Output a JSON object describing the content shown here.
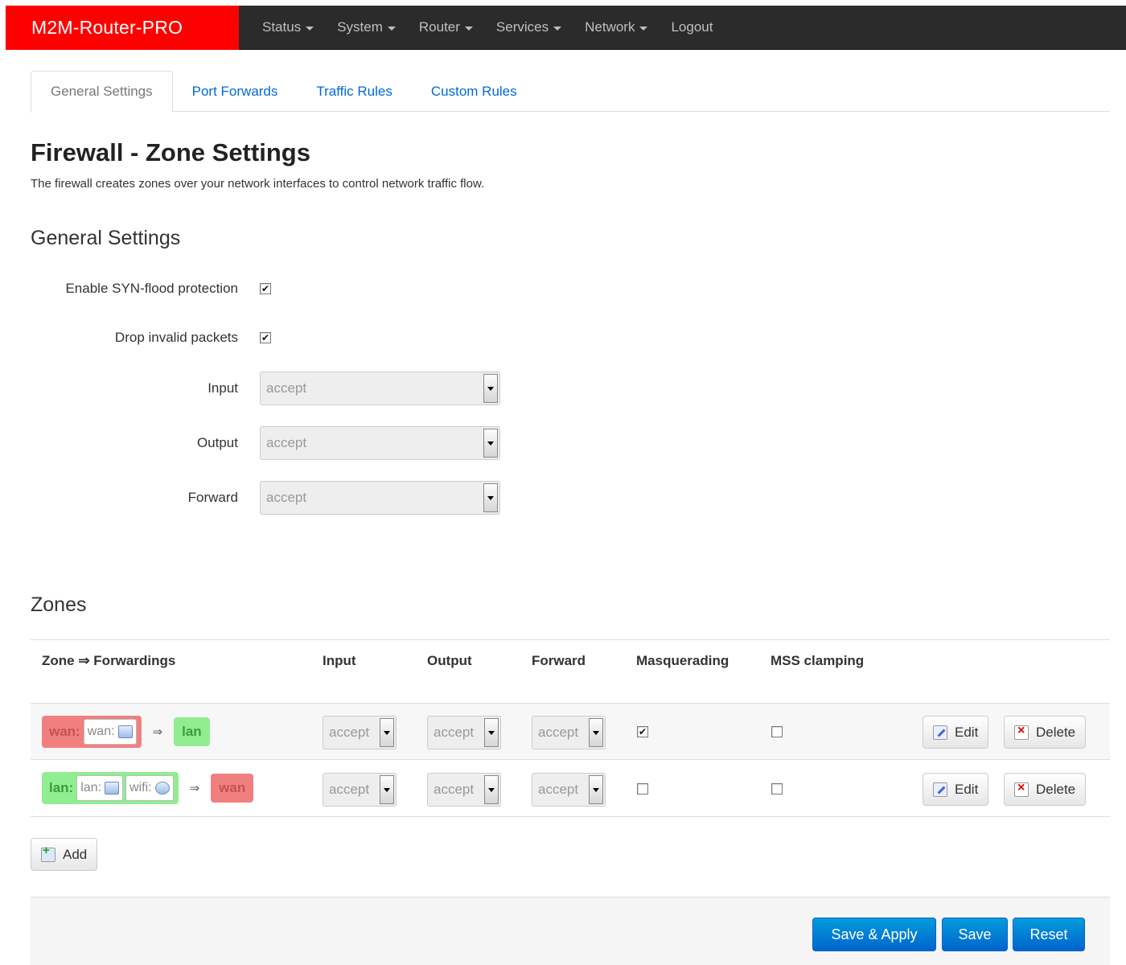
{
  "brand": "M2M-Router-PRO",
  "nav": [
    {
      "label": "Status",
      "dropdown": true
    },
    {
      "label": "System",
      "dropdown": true
    },
    {
      "label": "Router",
      "dropdown": true
    },
    {
      "label": "Services",
      "dropdown": true
    },
    {
      "label": "Network",
      "dropdown": true
    },
    {
      "label": "Logout",
      "dropdown": false
    }
  ],
  "tabs": [
    "General Settings",
    "Port Forwards",
    "Traffic Rules",
    "Custom Rules"
  ],
  "active_tab": "General Settings",
  "page_title": "Firewall - Zone Settings",
  "page_description": "The firewall creates zones over your network interfaces to control network traffic flow.",
  "general": {
    "title": "General Settings",
    "syn_label": "Enable SYN-flood protection",
    "syn_checked": true,
    "drop_label": "Drop invalid packets",
    "drop_checked": true,
    "input_label": "Input",
    "input_value": "accept",
    "output_label": "Output",
    "output_value": "accept",
    "forward_label": "Forward",
    "forward_value": "accept"
  },
  "zones": {
    "title": "Zones",
    "headers": {
      "zone": "Zone ⇒ Forwardings",
      "input": "Input",
      "output": "Output",
      "forward": "Forward",
      "masq": "Masquerading",
      "mss": "MSS clamping"
    },
    "arrow": "⇒",
    "rows": [
      {
        "zone": "wan:",
        "zone_color": "red",
        "interfaces": [
          {
            "label": "wan:",
            "icon": "ethernet-icon"
          }
        ],
        "forward_to": "lan",
        "forward_color": "green",
        "input": "accept",
        "output": "accept",
        "forward": "accept",
        "masquerading": true,
        "mss_clamping": false
      },
      {
        "zone": "lan:",
        "zone_color": "green",
        "interfaces": [
          {
            "label": "lan:",
            "icon": "network-icon"
          },
          {
            "label": "wifi:",
            "icon": "wifi-icon"
          }
        ],
        "forward_to": "wan",
        "forward_color": "red",
        "input": "accept",
        "output": "accept",
        "forward": "accept",
        "masquerading": false,
        "mss_clamping": false
      }
    ],
    "edit_label": "Edit",
    "delete_label": "Delete",
    "add_label": "Add"
  },
  "footer": {
    "save_apply": "Save & Apply",
    "save": "Save",
    "reset": "Reset"
  },
  "colors": {
    "brand_bg": "#ff0000",
    "navbar_bg": "#2b2b2b",
    "zone_red": "#f08080",
    "zone_green": "#90ee90",
    "primary_button": "#0064cd"
  }
}
